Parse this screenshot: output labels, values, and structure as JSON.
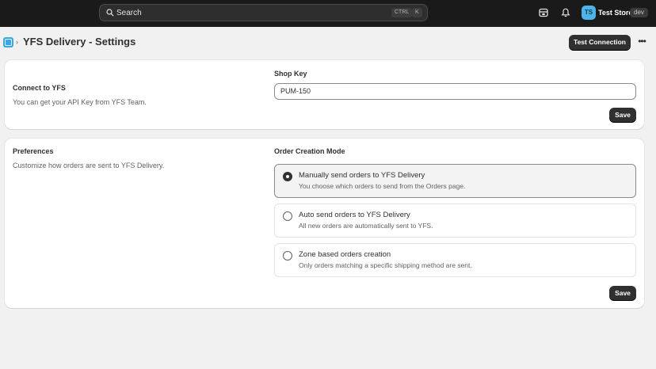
{
  "topbar": {
    "search_label": "Search",
    "shortcut_ctrl": "CTRL",
    "shortcut_k": "K",
    "avatar_initials": "TS",
    "store_name": "Test Store",
    "env_badge": "dev",
    "icons": [
      "search-icon",
      "store-icon",
      "bell-icon"
    ],
    "accent": "#4fb3e8"
  },
  "header": {
    "title": "YFS Delivery - Settings",
    "breadcrumb_separator": "›",
    "test_button": "Test Connection",
    "more": "•••"
  },
  "connect": {
    "title": "Connect to YFS",
    "description": "You can get your API Key from YFS Team.",
    "field_label": "Shop Key",
    "field_value": "PUM-150",
    "save": "Save"
  },
  "preferences": {
    "title": "Preferences",
    "description": "Customize how orders are sent to YFS Delivery.",
    "field_label": "Order Creation Mode",
    "options": [
      {
        "title": "Manually send orders to YFS Delivery",
        "description": "You choose which orders to send from the Orders page.",
        "selected": true
      },
      {
        "title": "Auto send orders to YFS Delivery",
        "description": "All new orders are automatically sent to YFS.",
        "selected": false
      },
      {
        "title": "Zone based orders creation",
        "description": "Only orders matching a specific shipping method are sent.",
        "selected": false
      }
    ],
    "save": "Save"
  }
}
